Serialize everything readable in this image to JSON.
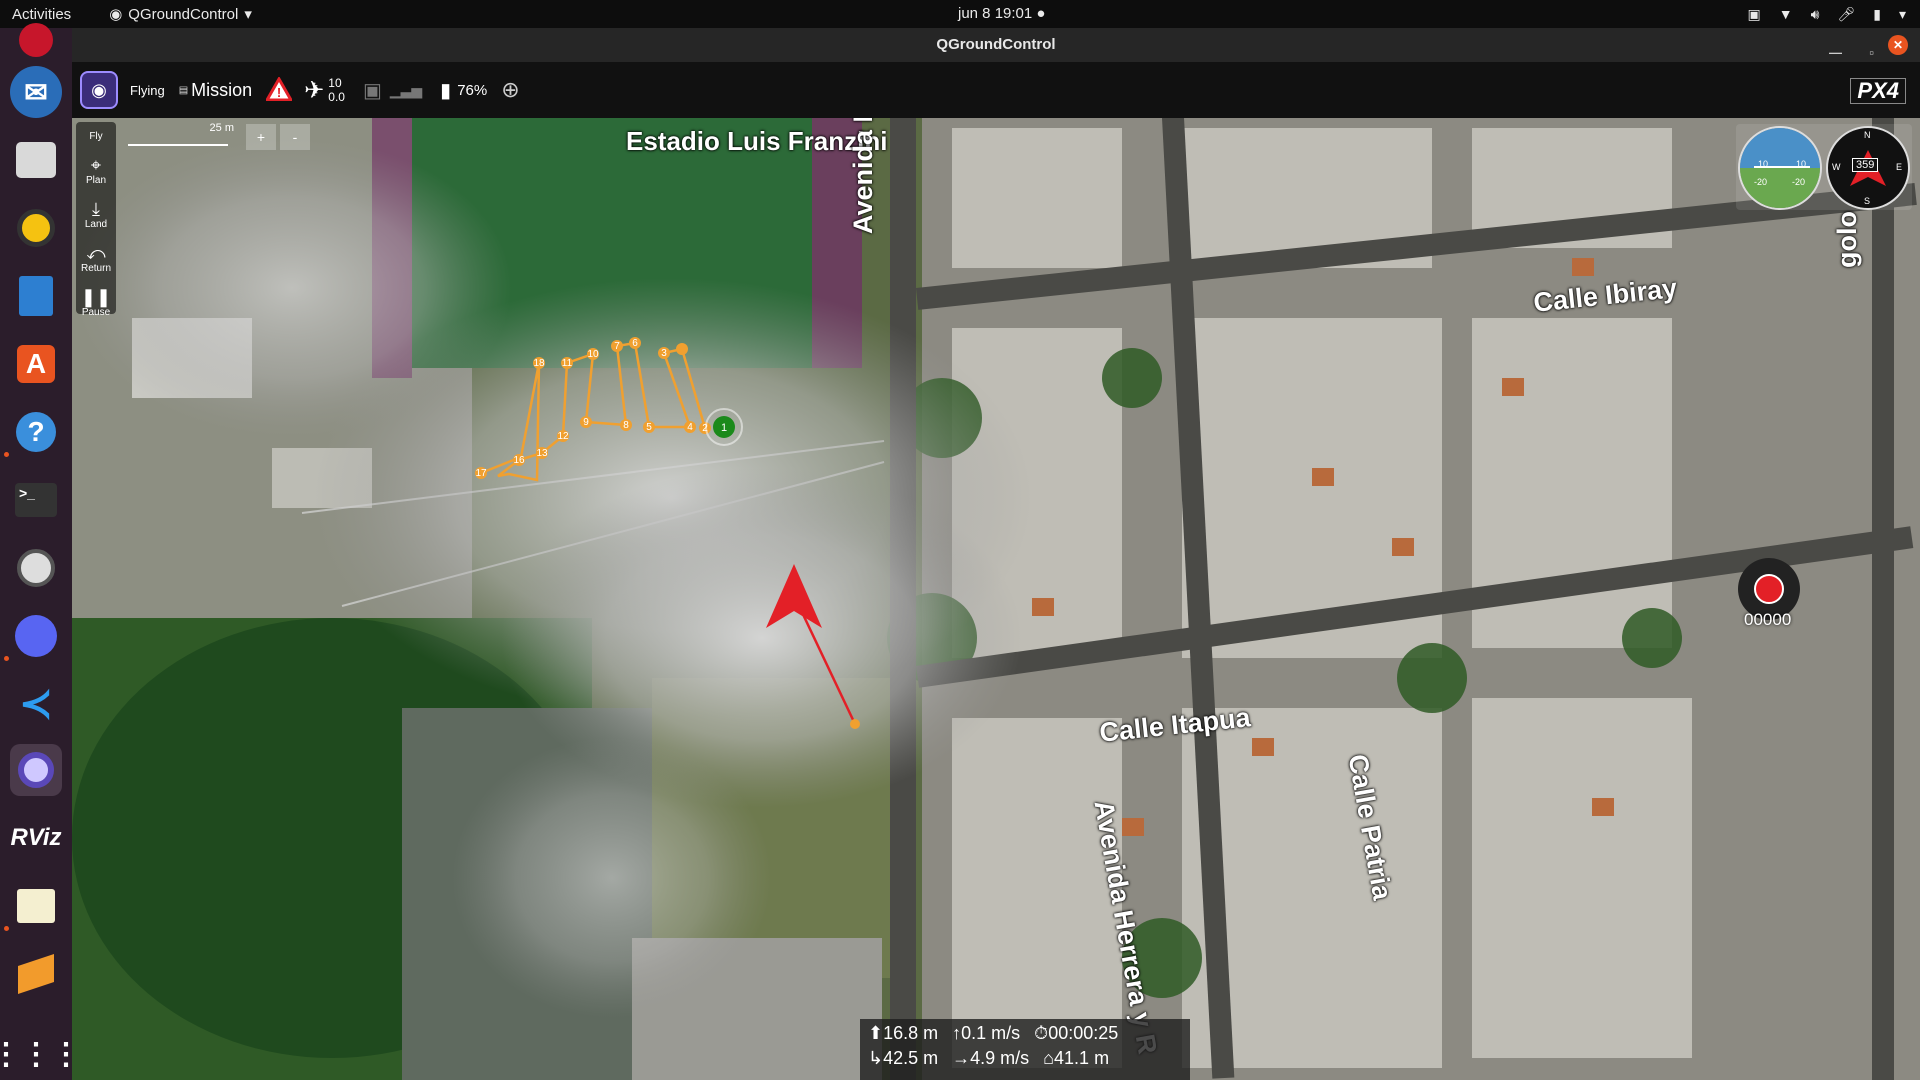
{
  "topbar": {
    "activities": "Activities",
    "app_menu": "QGroundControl",
    "clock": "jun 8  19:01"
  },
  "window": {
    "title": "QGroundControl"
  },
  "toolbar": {
    "flight_mode": "Flying",
    "mission_label": "Mission",
    "gps_sats": "10",
    "gps_hdop": "0.0",
    "battery": "76%",
    "brand": "PX4"
  },
  "tools": [
    {
      "label": "Fly",
      "icon": "fly-icon"
    },
    {
      "label": "Plan",
      "icon": "plan-icon"
    },
    {
      "label": "Land",
      "icon": "land-icon"
    },
    {
      "label": "Return",
      "icon": "return-icon"
    },
    {
      "label": "Pause",
      "icon": "pause-icon"
    }
  ],
  "map": {
    "scale_label": "25 m",
    "zoom_in": "+",
    "zoom_out": "-",
    "streets": {
      "stadium": "Estadio Luis Franzini",
      "herrera_top": "Avenida Herrera",
      "herrera_bottom": "Avenida Herrera y R",
      "ibiray": "Calle Ibiray",
      "itapua": "Calle Itapua",
      "patria": "Calle Patria",
      "edge_top": "golo"
    },
    "waypoints": [
      "1",
      "2",
      "3",
      "4",
      "5",
      "6",
      "7",
      "8",
      "9",
      "10",
      "11",
      "12",
      "13",
      "16",
      "17",
      "18"
    ]
  },
  "telemetry": {
    "altitude": "16.8 m",
    "vertical_speed": "0.1 m/s",
    "flight_time": "00:00:25",
    "distance": "42.5 m",
    "ground_speed": "4.9 m/s",
    "home_distance": "41.1 m"
  },
  "instruments": {
    "attitude_ticks": [
      "10",
      "10",
      "-20",
      "-20"
    ],
    "heading": "359",
    "compass": [
      "N",
      "E",
      "W",
      "S"
    ]
  },
  "camera": {
    "counter": "00000"
  },
  "colors": {
    "mission": "#f0a030",
    "vehicle": "#e32027",
    "accent": "#e95420"
  }
}
